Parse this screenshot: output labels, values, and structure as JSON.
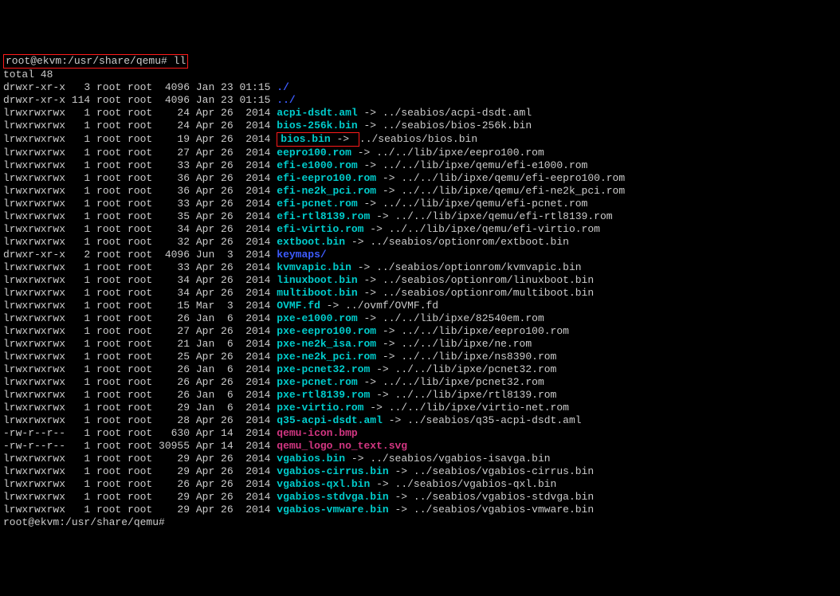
{
  "prompt_user": "root@ekvm",
  "prompt_path": "/usr/share/qemu",
  "prompt_symbol": "#",
  "command": "ll",
  "total_line": "total 48",
  "lines": [
    {
      "perm": "drwxr-xr-x",
      "links": "3",
      "owner": "root",
      "group": "root",
      "size": "4096",
      "date": "Jan 23 01:15",
      "name": "./",
      "type": "dir"
    },
    {
      "perm": "drwxr-xr-x",
      "links": "114",
      "owner": "root",
      "group": "root",
      "size": "4096",
      "date": "Jan 23 01:15",
      "name": "../",
      "type": "dir"
    },
    {
      "perm": "lrwxrwxrwx",
      "links": "1",
      "owner": "root",
      "group": "root",
      "size": "24",
      "date": "Apr 26  2014",
      "name": "acpi-dsdt.aml",
      "type": "link",
      "target": "../seabios/acpi-dsdt.aml"
    },
    {
      "perm": "lrwxrwxrwx",
      "links": "1",
      "owner": "root",
      "group": "root",
      "size": "24",
      "date": "Apr 26  2014",
      "name": "bios-256k.bin",
      "type": "link",
      "target": "../seabios/bios-256k.bin"
    },
    {
      "perm": "lrwxrwxrwx",
      "links": "1",
      "owner": "root",
      "group": "root",
      "size": "19",
      "date": "Apr 26  2014",
      "name": "bios.bin",
      "type": "link",
      "target": "../seabios/bios.bin",
      "box": true
    },
    {
      "perm": "lrwxrwxrwx",
      "links": "1",
      "owner": "root",
      "group": "root",
      "size": "27",
      "date": "Apr 26  2014",
      "name": "eepro100.rom",
      "type": "link",
      "target": "../../lib/ipxe/eepro100.rom"
    },
    {
      "perm": "lrwxrwxrwx",
      "links": "1",
      "owner": "root",
      "group": "root",
      "size": "33",
      "date": "Apr 26  2014",
      "name": "efi-e1000.rom",
      "type": "link",
      "target": "../../lib/ipxe/qemu/efi-e1000.rom"
    },
    {
      "perm": "lrwxrwxrwx",
      "links": "1",
      "owner": "root",
      "group": "root",
      "size": "36",
      "date": "Apr 26  2014",
      "name": "efi-eepro100.rom",
      "type": "link",
      "target": "../../lib/ipxe/qemu/efi-eepro100.rom"
    },
    {
      "perm": "lrwxrwxrwx",
      "links": "1",
      "owner": "root",
      "group": "root",
      "size": "36",
      "date": "Apr 26  2014",
      "name": "efi-ne2k_pci.rom",
      "type": "link",
      "target": "../../lib/ipxe/qemu/efi-ne2k_pci.rom"
    },
    {
      "perm": "lrwxrwxrwx",
      "links": "1",
      "owner": "root",
      "group": "root",
      "size": "33",
      "date": "Apr 26  2014",
      "name": "efi-pcnet.rom",
      "type": "link",
      "target": "../../lib/ipxe/qemu/efi-pcnet.rom"
    },
    {
      "perm": "lrwxrwxrwx",
      "links": "1",
      "owner": "root",
      "group": "root",
      "size": "35",
      "date": "Apr 26  2014",
      "name": "efi-rtl8139.rom",
      "type": "link",
      "target": "../../lib/ipxe/qemu/efi-rtl8139.rom"
    },
    {
      "perm": "lrwxrwxrwx",
      "links": "1",
      "owner": "root",
      "group": "root",
      "size": "34",
      "date": "Apr 26  2014",
      "name": "efi-virtio.rom",
      "type": "link",
      "target": "../../lib/ipxe/qemu/efi-virtio.rom"
    },
    {
      "perm": "lrwxrwxrwx",
      "links": "1",
      "owner": "root",
      "group": "root",
      "size": "32",
      "date": "Apr 26  2014",
      "name": "extboot.bin",
      "type": "link",
      "target": "../seabios/optionrom/extboot.bin"
    },
    {
      "perm": "drwxr-xr-x",
      "links": "2",
      "owner": "root",
      "group": "root",
      "size": "4096",
      "date": "Jun  3  2014",
      "name": "keymaps/",
      "type": "dir"
    },
    {
      "perm": "lrwxrwxrwx",
      "links": "1",
      "owner": "root",
      "group": "root",
      "size": "33",
      "date": "Apr 26  2014",
      "name": "kvmvapic.bin",
      "type": "link",
      "target": "../seabios/optionrom/kvmvapic.bin"
    },
    {
      "perm": "lrwxrwxrwx",
      "links": "1",
      "owner": "root",
      "group": "root",
      "size": "34",
      "date": "Apr 26  2014",
      "name": "linuxboot.bin",
      "type": "link",
      "target": "../seabios/optionrom/linuxboot.bin"
    },
    {
      "perm": "lrwxrwxrwx",
      "links": "1",
      "owner": "root",
      "group": "root",
      "size": "34",
      "date": "Apr 26  2014",
      "name": "multiboot.bin",
      "type": "link",
      "target": "../seabios/optionrom/multiboot.bin"
    },
    {
      "perm": "lrwxrwxrwx",
      "links": "1",
      "owner": "root",
      "group": "root",
      "size": "15",
      "date": "Mar  3  2014",
      "name": "OVMF.fd",
      "type": "link",
      "target": "../ovmf/OVMF.fd"
    },
    {
      "perm": "lrwxrwxrwx",
      "links": "1",
      "owner": "root",
      "group": "root",
      "size": "26",
      "date": "Jan  6  2014",
      "name": "pxe-e1000.rom",
      "type": "link",
      "target": "../../lib/ipxe/82540em.rom"
    },
    {
      "perm": "lrwxrwxrwx",
      "links": "1",
      "owner": "root",
      "group": "root",
      "size": "27",
      "date": "Apr 26  2014",
      "name": "pxe-eepro100.rom",
      "type": "link",
      "target": "../../lib/ipxe/eepro100.rom"
    },
    {
      "perm": "lrwxrwxrwx",
      "links": "1",
      "owner": "root",
      "group": "root",
      "size": "21",
      "date": "Jan  6  2014",
      "name": "pxe-ne2k_isa.rom",
      "type": "link",
      "target": "../../lib/ipxe/ne.rom"
    },
    {
      "perm": "lrwxrwxrwx",
      "links": "1",
      "owner": "root",
      "group": "root",
      "size": "25",
      "date": "Apr 26  2014",
      "name": "pxe-ne2k_pci.rom",
      "type": "link",
      "target": "../../lib/ipxe/ns8390.rom"
    },
    {
      "perm": "lrwxrwxrwx",
      "links": "1",
      "owner": "root",
      "group": "root",
      "size": "26",
      "date": "Jan  6  2014",
      "name": "pxe-pcnet32.rom",
      "type": "link",
      "target": "../../lib/ipxe/pcnet32.rom"
    },
    {
      "perm": "lrwxrwxrwx",
      "links": "1",
      "owner": "root",
      "group": "root",
      "size": "26",
      "date": "Apr 26  2014",
      "name": "pxe-pcnet.rom",
      "type": "link",
      "target": "../../lib/ipxe/pcnet32.rom"
    },
    {
      "perm": "lrwxrwxrwx",
      "links": "1",
      "owner": "root",
      "group": "root",
      "size": "26",
      "date": "Jan  6  2014",
      "name": "pxe-rtl8139.rom",
      "type": "link",
      "target": "../../lib/ipxe/rtl8139.rom"
    },
    {
      "perm": "lrwxrwxrwx",
      "links": "1",
      "owner": "root",
      "group": "root",
      "size": "29",
      "date": "Jan  6  2014",
      "name": "pxe-virtio.rom",
      "type": "link",
      "target": "../../lib/ipxe/virtio-net.rom"
    },
    {
      "perm": "lrwxrwxrwx",
      "links": "1",
      "owner": "root",
      "group": "root",
      "size": "28",
      "date": "Apr 26  2014",
      "name": "q35-acpi-dsdt.aml",
      "type": "link",
      "target": "../seabios/q35-acpi-dsdt.aml"
    },
    {
      "perm": "-rw-r--r--",
      "links": "1",
      "owner": "root",
      "group": "root",
      "size": "630",
      "date": "Apr 14  2014",
      "name": "qemu-icon.bmp",
      "type": "mag"
    },
    {
      "perm": "-rw-r--r--",
      "links": "1",
      "owner": "root",
      "group": "root",
      "size": "30955",
      "date": "Apr 14  2014",
      "name": "qemu_logo_no_text.svg",
      "type": "mag"
    },
    {
      "perm": "lrwxrwxrwx",
      "links": "1",
      "owner": "root",
      "group": "root",
      "size": "29",
      "date": "Apr 26  2014",
      "name": "vgabios.bin",
      "type": "link",
      "target": "../seabios/vgabios-isavga.bin"
    },
    {
      "perm": "lrwxrwxrwx",
      "links": "1",
      "owner": "root",
      "group": "root",
      "size": "29",
      "date": "Apr 26  2014",
      "name": "vgabios-cirrus.bin",
      "type": "link",
      "target": "../seabios/vgabios-cirrus.bin"
    },
    {
      "perm": "lrwxrwxrwx",
      "links": "1",
      "owner": "root",
      "group": "root",
      "size": "26",
      "date": "Apr 26  2014",
      "name": "vgabios-qxl.bin",
      "type": "link",
      "target": "../seabios/vgabios-qxl.bin"
    },
    {
      "perm": "lrwxrwxrwx",
      "links": "1",
      "owner": "root",
      "group": "root",
      "size": "29",
      "date": "Apr 26  2014",
      "name": "vgabios-stdvga.bin",
      "type": "link",
      "target": "../seabios/vgabios-stdvga.bin"
    },
    {
      "perm": "lrwxrwxrwx",
      "links": "1",
      "owner": "root",
      "group": "root",
      "size": "29",
      "date": "Apr 26  2014",
      "name": "vgabios-vmware.bin",
      "type": "link",
      "target": "../seabios/vgabios-vmware.bin"
    }
  ]
}
